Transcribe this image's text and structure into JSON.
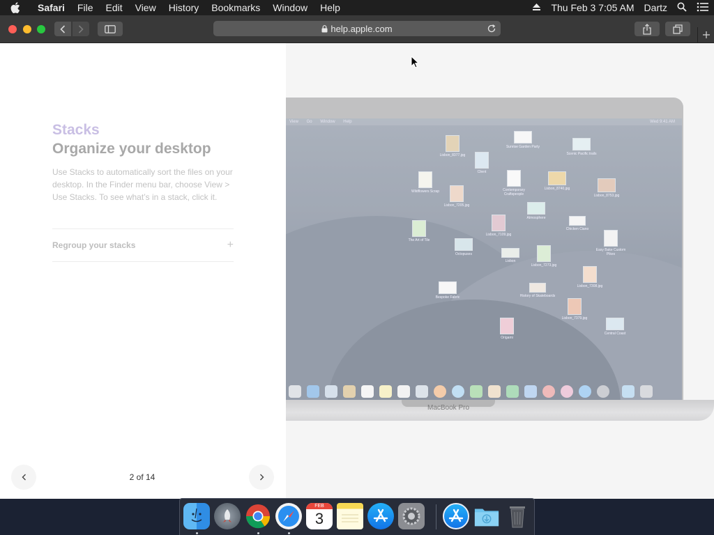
{
  "menubar": {
    "app_name": "Safari",
    "menus": [
      "File",
      "Edit",
      "View",
      "History",
      "Bookmarks",
      "Window",
      "Help"
    ],
    "clock": "Thu Feb 3  7:05 AM",
    "user": "Dartz"
  },
  "browser": {
    "address": "help.apple.com"
  },
  "article": {
    "feature_name": "Stacks",
    "headline": "Organize your desktop",
    "body": "Use Stacks to automatically sort the files on your desktop. In the Finder menu bar, choose View > Use Stacks. To see what’s in a stack, click it.",
    "accordion_label": "Regroup your stacks",
    "accordion_icon": "+",
    "page_indicator": "2 of 14"
  },
  "laptop_image": {
    "label": "MacBook Pro",
    "menubar_items": [
      "View",
      "Go",
      "Window",
      "Help"
    ],
    "menubar_time": "Wed 9:41 AM",
    "files": [
      {
        "name": "Lisbon_8377.jpg"
      },
      {
        "name": "Sunrise Garden Party"
      },
      {
        "name": "Scenic Pacific trails"
      },
      {
        "name": "Client"
      },
      {
        "name": "Wildflowers Scrap"
      },
      {
        "name": "Lisbon_7205.jpg"
      },
      {
        "name": "Contemporary Craftspeople"
      },
      {
        "name": "Lisbon_8740.jpg"
      },
      {
        "name": "Lisbon_8753.jpg"
      },
      {
        "name": "Atmosphere"
      },
      {
        "name": "Chicken Ciano"
      },
      {
        "name": "The Art of Tile"
      },
      {
        "name": "Lisbon_7109.jpg"
      },
      {
        "name": "Octopuses"
      },
      {
        "name": "Lisbon"
      },
      {
        "name": "Lisbon_7273.jpg"
      },
      {
        "name": "Lisbon_7308.jpg"
      },
      {
        "name": "Easy Bake Custom Pikes"
      },
      {
        "name": "Bespoke Fabric"
      },
      {
        "name": "History of Skateboards"
      },
      {
        "name": "Lisbon_7379.jpg"
      },
      {
        "name": "Origami"
      },
      {
        "name": "Central Coast"
      }
    ]
  },
  "dock": {
    "apps": [
      "Finder",
      "Launchpad",
      "Chrome",
      "Safari",
      "Calendar",
      "Notes",
      "App Store",
      "System Preferences",
      "App Store",
      "Downloads",
      "Trash"
    ],
    "calendar_month": "FEB",
    "calendar_day": "3"
  }
}
